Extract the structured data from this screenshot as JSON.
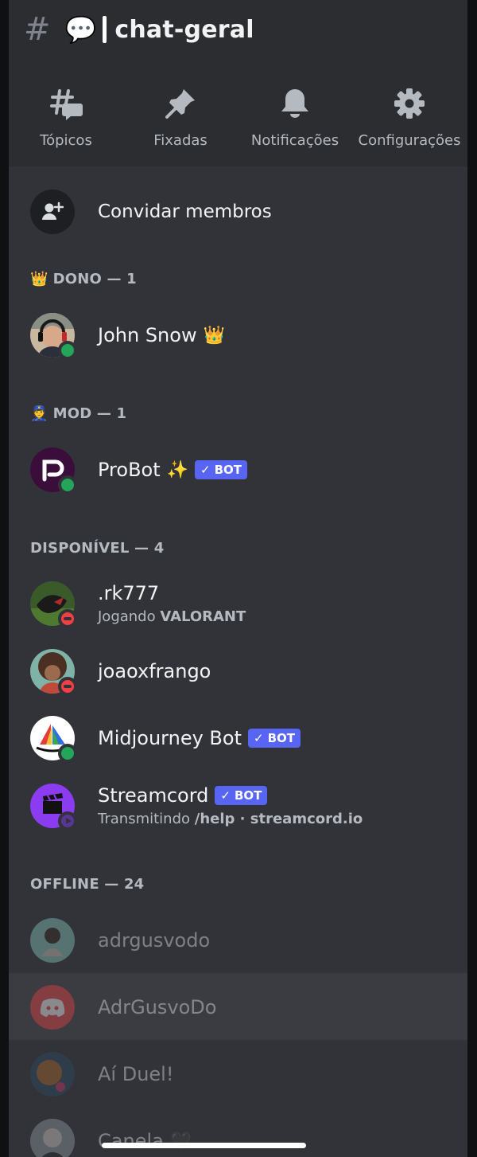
{
  "header": {
    "channel_icon": "hash-icon",
    "emoji": "💬",
    "title": "chat-geral"
  },
  "actions": [
    {
      "label": "Tópicos",
      "icon": "threads-icon"
    },
    {
      "label": "Fixadas",
      "icon": "pin-icon"
    },
    {
      "label": "Notificações",
      "icon": "bell-icon"
    },
    {
      "label": "Configurações",
      "icon": "gear-icon"
    }
  ],
  "invite": {
    "label": "Convidar membros",
    "icon": "add-user-icon"
  },
  "sections": {
    "owner": {
      "emoji": "👑",
      "title": "DONO — 1"
    },
    "mod": {
      "emoji": "👮",
      "title": "MOD — 1"
    },
    "available": {
      "title": "DISPONÍVEL — 4"
    },
    "offline": {
      "title": "OFFLINE — 24"
    }
  },
  "members": {
    "john": {
      "name": "John Snow",
      "emoji": "👑",
      "status": "online"
    },
    "probot": {
      "name": "ProBot",
      "emoji": "✨",
      "badge": "BOT",
      "status": "online"
    },
    "rk": {
      "name": ".rk777",
      "activity_prefix": "Jogando",
      "activity": "VALORANT",
      "status": "dnd"
    },
    "joao": {
      "name": "joaoxfrango",
      "status": "dnd"
    },
    "midjourney": {
      "name": "Midjourney Bot",
      "badge": "BOT",
      "status": "online"
    },
    "streamcord": {
      "name": "Streamcord",
      "badge": "BOT",
      "activity_prefix": "Transmitindo",
      "activity": "/help · streamcord.io",
      "status": "streaming"
    },
    "adrgusvodo": {
      "name": "adrgusvodo"
    },
    "adrgusvodo2": {
      "name": "AdrGusvoDo"
    },
    "aiduel": {
      "name": "Aí Duel!"
    },
    "canela": {
      "name": "Canela",
      "emoji": "🖤"
    }
  },
  "colors": {
    "accent": "#5865f2",
    "online": "#23a55a",
    "dnd": "#f23f43",
    "streaming": "#593695"
  }
}
